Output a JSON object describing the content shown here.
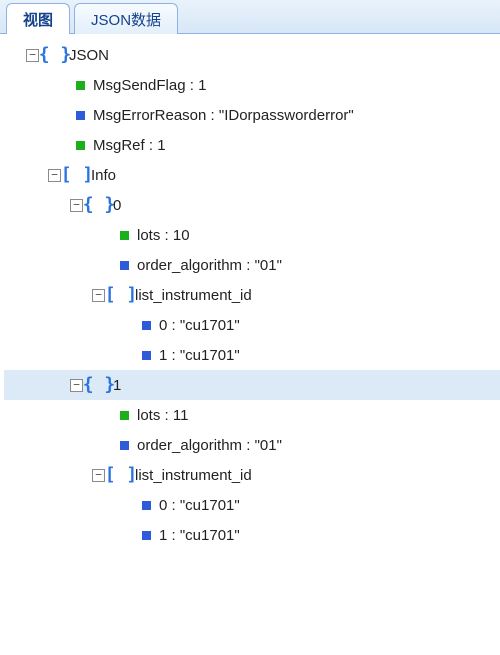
{
  "tabs": {
    "view": "视图",
    "json": "JSON数据"
  },
  "expander": {
    "collapse": "−",
    "expand": "+"
  },
  "icons": {
    "obj": "{ }",
    "arr": "[ ]"
  },
  "tree": {
    "root": "JSON",
    "msgSendFlag": {
      "key": "MsgSendFlag",
      "value": "1"
    },
    "msgErrorReason": {
      "key": "MsgErrorReason",
      "value": "\"IDorpassworderror\""
    },
    "msgRef": {
      "key": "MsgRef",
      "value": "1"
    },
    "info": {
      "key": "Info",
      "items": [
        {
          "idx": "0",
          "lots": {
            "key": "lots",
            "value": "10"
          },
          "algo": {
            "key": "order_algorithm",
            "value": "\"01\""
          },
          "list": {
            "key": "list_instrument_id",
            "entries": [
              {
                "k": "0",
                "v": "\"cu1701\""
              },
              {
                "k": "1",
                "v": "\"cu1701\""
              }
            ]
          }
        },
        {
          "idx": "1",
          "lots": {
            "key": "lots",
            "value": "11"
          },
          "algo": {
            "key": "order_algorithm",
            "value": "\"01\""
          },
          "list": {
            "key": "list_instrument_id",
            "entries": [
              {
                "k": "0",
                "v": "\"cu1701\""
              },
              {
                "k": "1",
                "v": "\"cu1701\""
              }
            ]
          }
        }
      ]
    }
  },
  "sep": " : "
}
